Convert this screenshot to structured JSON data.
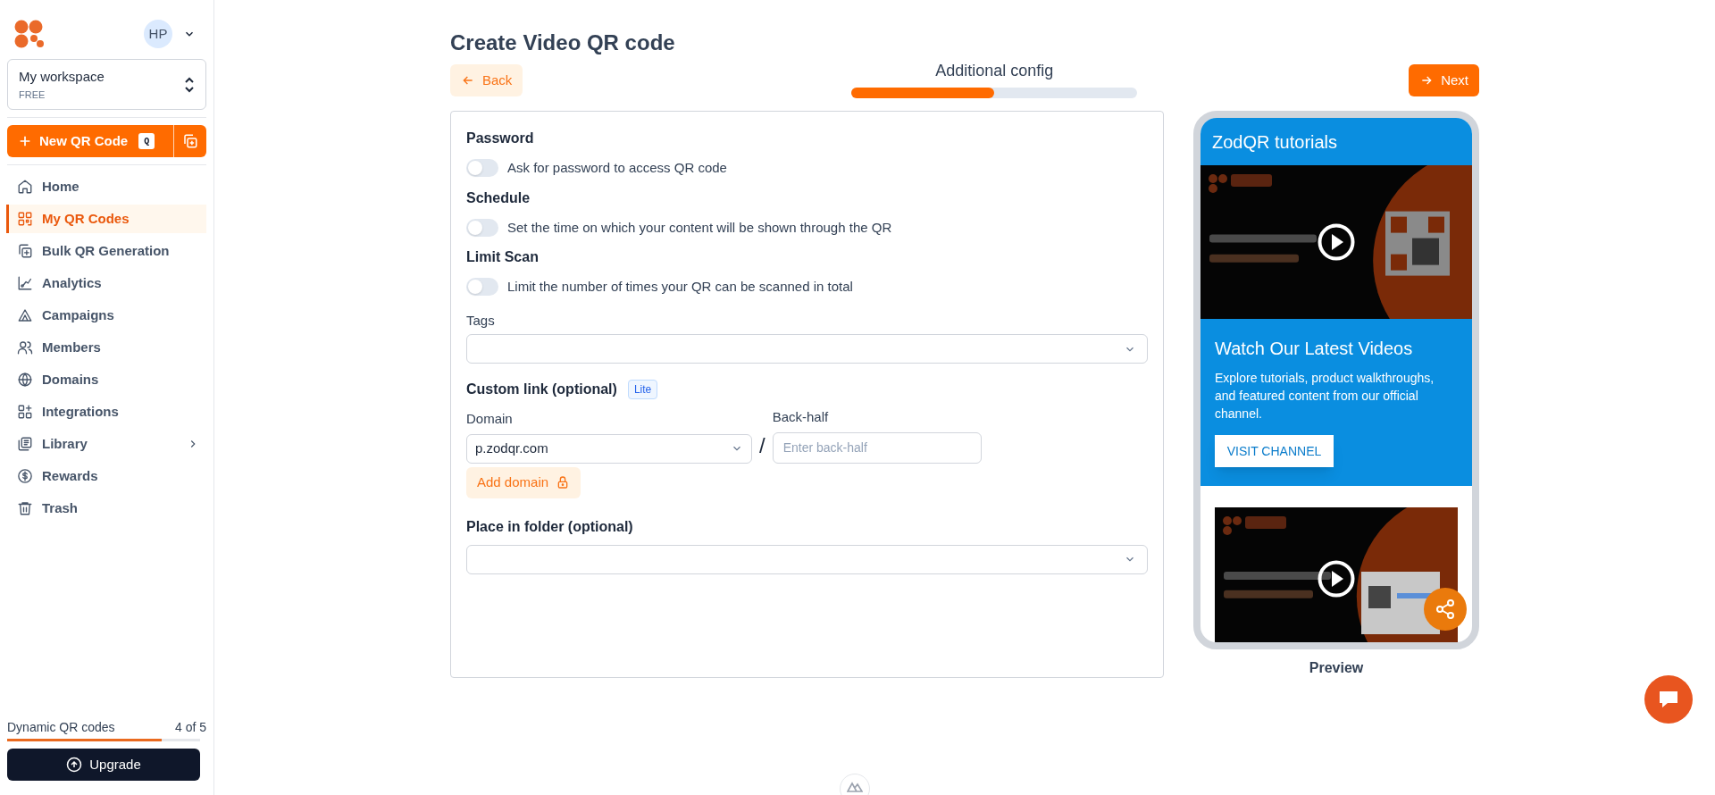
{
  "sidebar": {
    "user_initials": "HP",
    "workspace": {
      "name": "My workspace",
      "plan": "FREE"
    },
    "new_button": {
      "label": "New QR Code",
      "shortcut": "Q"
    },
    "nav": [
      {
        "label": "Home",
        "selected": false,
        "has_submenu": false
      },
      {
        "label": "My QR Codes",
        "selected": true,
        "has_submenu": false
      },
      {
        "label": "Bulk QR Generation",
        "selected": false,
        "has_submenu": false
      },
      {
        "label": "Analytics",
        "selected": false,
        "has_submenu": false
      },
      {
        "label": "Campaigns",
        "selected": false,
        "has_submenu": false
      },
      {
        "label": "Members",
        "selected": false,
        "has_submenu": false
      },
      {
        "label": "Domains",
        "selected": false,
        "has_submenu": false
      },
      {
        "label": "Integrations",
        "selected": false,
        "has_submenu": false
      },
      {
        "label": "Library",
        "selected": false,
        "has_submenu": true
      },
      {
        "label": "Rewards",
        "selected": false,
        "has_submenu": false
      },
      {
        "label": "Trash",
        "selected": false,
        "has_submenu": false
      }
    ],
    "usage": {
      "label": "Dynamic QR codes",
      "count": "4 of 5",
      "level": 0.8
    },
    "upgrade": "Upgrade"
  },
  "header": {
    "title": "Create Video QR code",
    "back": "Back",
    "next": "Next",
    "progress": {
      "label": "Additional config",
      "level": 0.5
    }
  },
  "toggles": [
    {
      "title": "Password",
      "label": "Ask for password to access QR code",
      "on": false
    },
    {
      "title": "Schedule",
      "label": "Set the time on which your content will be shown through the QR",
      "on": false
    },
    {
      "title": "Limit Scan",
      "label": "Limit the number of times your QR can be scanned in total",
      "on": false
    }
  ],
  "tags": {
    "label": "Tags"
  },
  "custom_link": {
    "title": "Custom link (optional)",
    "badge": "Lite",
    "domain_label": "Domain",
    "domain_value": "p.zodqr.com",
    "separator": "/",
    "backhalf_label": "Back-half",
    "backhalf_placeholder": "Enter back-half",
    "add_domain": "Add domain"
  },
  "folder": {
    "label": "Place in folder (optional)"
  },
  "preview": {
    "heading": "ZodQR tutorials",
    "promo_title": "Watch Our Latest Videos",
    "promo_text": "Explore tutorials, product walkthroughs, and featured content from our official channel.",
    "promo_button": "VISIT CHANNEL",
    "caption": "Preview"
  }
}
